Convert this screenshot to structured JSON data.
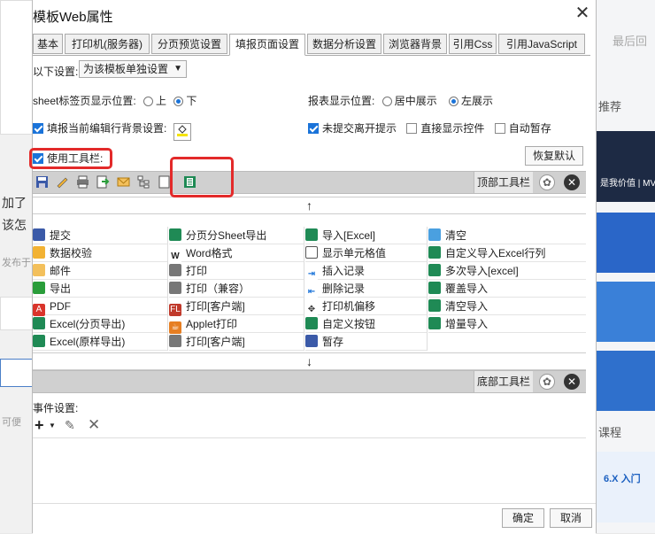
{
  "background": {
    "left_texts": [
      "加了",
      "该怎",
      "发布于",
      "可便"
    ],
    "right_texts": [
      "最后回",
      "推荐",
      "课程"
    ],
    "right_tiles": [
      "是我价值 | MV",
      "6.X 入门"
    ]
  },
  "dialog": {
    "title": "模板Web属性",
    "tabs": [
      "基本",
      "打印机(服务器)",
      "分页预览设置",
      "填报页面设置",
      "数据分析设置",
      "浏览器背景",
      "引用Css",
      "引用JavaScript"
    ],
    "active_tab": "填报页面设置",
    "settings_label": "以下设置:",
    "settings_value": "为该模板单独设置",
    "sheet_tab_label": "sheet标签页显示位置:",
    "sheet_tab_options": [
      "上",
      "下"
    ],
    "sheet_tab_selected": "下",
    "report_pos_label": "报表显示位置:",
    "report_pos_options": [
      "居中展示",
      "左展示"
    ],
    "report_pos_selected": "左展示",
    "bg_label": "填报当前编辑行背景设置:",
    "bg_checked": true,
    "unsubmitted_label": "未提交离开提示",
    "unsubmitted_checked": true,
    "direct_label": "直接显示控件",
    "direct_checked": false,
    "autosave_label": "自动暂存",
    "autosave_checked": false,
    "use_toolbar_label": "使用工具栏:",
    "use_toolbar_checked": true,
    "restore_button": "恢复默认",
    "top_toolbar_label": "顶部工具栏",
    "bottom_toolbar_label": "底部工具栏",
    "top_toolbar_icons": [
      "save-icon",
      "edit-icon",
      "print-icon",
      "export-icon",
      "email-icon",
      "tree-icon",
      "blank-icon",
      "excel-icon"
    ],
    "grid": [
      [
        {
          "label": "提交",
          "icon": "save-icon"
        },
        {
          "label": "分页分Sheet导出",
          "icon": "excel-icon"
        },
        {
          "label": "导入[Excel]",
          "icon": "excel-icon"
        },
        {
          "label": "清空",
          "icon": "eraser-icon"
        }
      ],
      [
        {
          "label": "数据校验",
          "icon": "pencil-icon"
        },
        {
          "label": "Word格式",
          "icon": "word-icon"
        },
        {
          "label": "显示单元格值",
          "icon": "cell-icon"
        },
        {
          "label": "自定义导入Excel行列",
          "icon": "excel-icon"
        }
      ],
      [
        {
          "label": "邮件",
          "icon": "email-icon"
        },
        {
          "label": "打印",
          "icon": "print-icon"
        },
        {
          "label": "插入记录",
          "icon": "insert-icon"
        },
        {
          "label": "多次导入[excel]",
          "icon": "excel-icon"
        }
      ],
      [
        {
          "label": "导出",
          "icon": "export-icon"
        },
        {
          "label": "打印（兼容）",
          "icon": "print-icon"
        },
        {
          "label": "删除记录",
          "icon": "delete-row-icon"
        },
        {
          "label": "覆盖导入",
          "icon": "excel-icon"
        }
      ],
      [
        {
          "label": "PDF",
          "icon": "pdf-icon"
        },
        {
          "label": "打印[客户端]",
          "icon": "print-client-icon"
        },
        {
          "label": "打印机偏移",
          "icon": "move-icon"
        },
        {
          "label": "清空导入",
          "icon": "excel-icon"
        }
      ],
      [
        {
          "label": "Excel(分页导出)",
          "icon": "excel-icon"
        },
        {
          "label": "Applet打印",
          "icon": "applet-icon"
        },
        {
          "label": "自定义按钮",
          "icon": "excel-icon"
        },
        {
          "label": "增量导入",
          "icon": "excel-icon"
        }
      ],
      [
        {
          "label": "Excel(原样导出)",
          "icon": "excel-icon"
        },
        {
          "label": "打印[客户端]",
          "icon": "print-icon"
        },
        {
          "label": "暂存",
          "icon": "save-icon"
        },
        {
          "label": "",
          "icon": ""
        }
      ]
    ],
    "event_label": "事件设置:",
    "ok_button": "确定",
    "cancel_button": "取消"
  }
}
